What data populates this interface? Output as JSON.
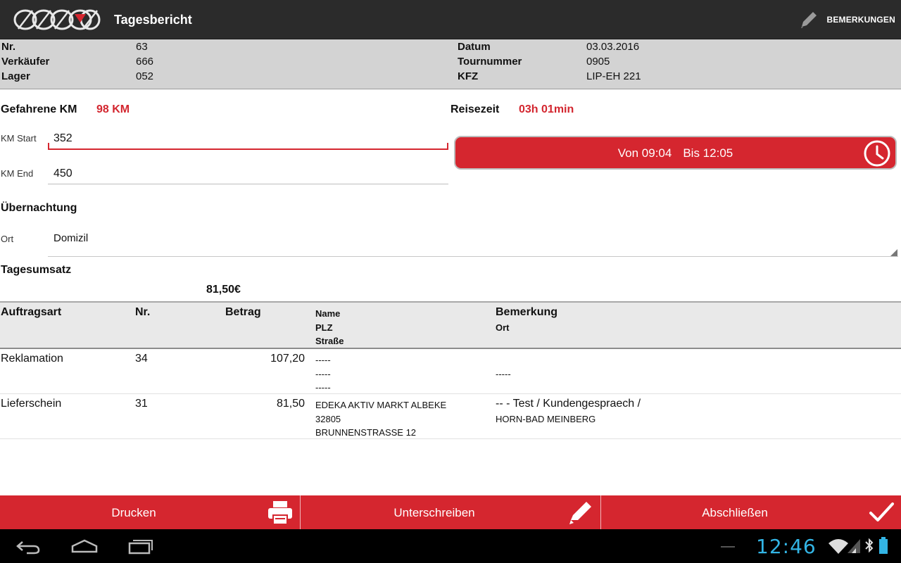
{
  "app": {
    "title": "Tagesbericht",
    "action_label": "BEMERKUNGEN",
    "icons": {
      "logo": "brand-logo",
      "action": "pencil-icon"
    }
  },
  "info": {
    "left": [
      {
        "label": "Nr.",
        "value": "63"
      },
      {
        "label": "Verkäufer",
        "value": "666"
      },
      {
        "label": "Lager",
        "value": "052"
      }
    ],
    "right": [
      {
        "label": "Datum",
        "value": "03.03.2016"
      },
      {
        "label": "Tournummer",
        "value": "0905"
      },
      {
        "label": "KFZ",
        "value": "LIP-EH 221"
      }
    ]
  },
  "km": {
    "label": "Gefahrene KM",
    "value": "98 KM",
    "start_label": "KM Start",
    "start_value": "352",
    "end_label": "KM End",
    "end_value": "450"
  },
  "travel": {
    "label": "Reisezeit",
    "value": "03h 01min",
    "from": "Von 09:04",
    "to": "Bis 12:05"
  },
  "overnight": {
    "label": "Übernachtung",
    "ort_label": "Ort",
    "ort_value": "Domizil"
  },
  "sales": {
    "label": "Tagesumsatz",
    "value": "81,50€"
  },
  "table": {
    "headers": {
      "type": "Auftragsart",
      "nr": "Nr.",
      "amount": "Betrag",
      "name": "Name",
      "plz": "PLZ",
      "street": "Straße",
      "remark": "Bemerkung",
      "ort": "Ort"
    },
    "rows": [
      {
        "type": "Reklamation",
        "nr": "34",
        "amount": "107,20",
        "name": "-----",
        "plz": "-----",
        "street": "-----",
        "remark": "",
        "ort": "-----"
      },
      {
        "type": "Lieferschein",
        "nr": "31",
        "amount": "81,50",
        "name": "EDEKA AKTIV MARKT ALBEKE",
        "plz": "32805",
        "street": "BRUNNENSTRASSE 12",
        "remark": "-- - Test / Kundengespraech /",
        "ort": "HORN-BAD MEINBERG"
      }
    ]
  },
  "buttons": [
    {
      "label": "Drucken",
      "icon": "printer-icon"
    },
    {
      "label": "Unterschreiben",
      "icon": "pencil-icon"
    },
    {
      "label": "Abschließen",
      "icon": "checkmark-icon"
    }
  ],
  "system": {
    "time": "12:46",
    "colors": {
      "accent": "#d5262f",
      "clock": "#33b5e5"
    }
  }
}
